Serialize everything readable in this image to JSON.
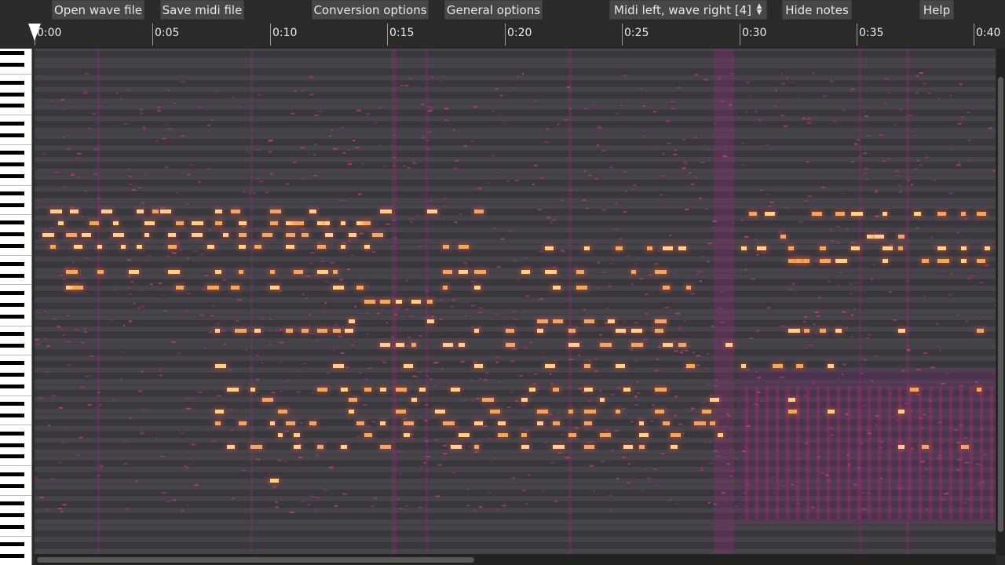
{
  "toolbar": {
    "open_wave": "Open wave file",
    "save_midi": "Save midi file",
    "conversion_options": "Conversion options",
    "general_options": "General options",
    "mode_select": "Midi left, wave right [4]",
    "hide_notes": "Hide notes",
    "help": "Help"
  },
  "timeline": {
    "ticks": [
      "0:00",
      "0:05",
      "0:10",
      "0:15",
      "0:20",
      "0:25",
      "0:30",
      "0:35",
      "0:40"
    ]
  },
  "colors": {
    "background": "#2b2b2b",
    "button": "#474747",
    "note": "#f8c27a",
    "spectrogram_glow": "#b0308a"
  },
  "icons": {
    "playhead": "playhead-triangle-icon",
    "mode_select_arrows": "up-down-arrows-icon"
  }
}
